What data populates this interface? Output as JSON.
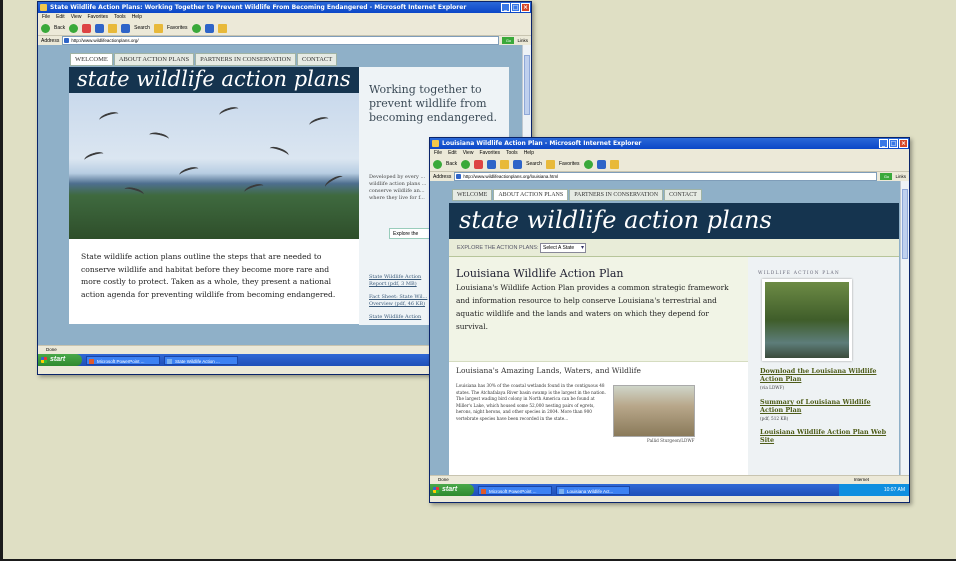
{
  "window1": {
    "title": "State Wildlife Action Plans: Working Together to Prevent Wildlife From Becoming Endangered - Microsoft Internet Explorer",
    "menu": [
      "File",
      "Edit",
      "View",
      "Favorites",
      "Tools",
      "Help"
    ],
    "toolbar": {
      "back": "Back",
      "search": "Search",
      "favorites": "Favorites"
    },
    "address_label": "Address",
    "address": "http://www.wildlifeactionplans.org/",
    "go": "Go",
    "links": "Links",
    "status": "Done",
    "taskbar": {
      "start": "start",
      "task1": "Microsoft PowerPoint ...",
      "task2": "State Wildlife Action ..."
    },
    "site": {
      "tabs": [
        "WELCOME",
        "ABOUT ACTION PLANS",
        "PARTNERS IN CONSERVATION",
        "CONTACT"
      ],
      "banner": "state wildlife action plans",
      "tagline": "Working together to prevent wildlife from becoming endangered.",
      "intro": "State wildlife action plans outline the steps that are needed to conserve wildlife and habitat before they become more rare and more costly to protect. Taken as a whole, they present a national action agenda for preventing wildlife from becoming endangered.",
      "side_text": "Developed by every ... wildlife action plans ... conserve wildlife an... where they live for f...",
      "explore_button": "Explore the",
      "side_links": [
        "State Wildlife Action Report (pdf, 3 MB)",
        "Fact Sheet: State Wil... Overview (pdf, 46 KB)",
        "State Wildlife Action"
      ]
    }
  },
  "window2": {
    "title": "Louisiana Wildlife Action Plan - Microsoft Internet Explorer",
    "menu": [
      "File",
      "Edit",
      "View",
      "Favorites",
      "Tools",
      "Help"
    ],
    "toolbar": {
      "back": "Back",
      "search": "Search",
      "favorites": "Favorites"
    },
    "address_label": "Address",
    "address": "http://www.wildlifeactionplans.org/louisiana.html",
    "go": "Go",
    "links": "Links",
    "status": "Done",
    "status_right": "Internet",
    "taskbar": {
      "start": "start",
      "task1": "Microsoft PowerPoint ...",
      "task2": "Louisiana Wildlife Act...",
      "clock": "10:07 AM"
    },
    "site": {
      "tabs": [
        "WELCOME",
        "ABOUT ACTION PLANS",
        "PARTNERS IN CONSERVATION",
        "CONTACT"
      ],
      "banner": "state wildlife action plans",
      "explore_label": "EXPLORE THE ACTION PLANS:",
      "select_value": "Select A State",
      "heading": "Louisiana Wildlife Action Plan",
      "intro": "Louisiana's Wildlife Action Plan provides a common strategic framework and information resource to help conserve Louisiana's terrestrial and aquatic wildlife and the lands and waters on which they depend for survival.",
      "subheading": "Louisiana's Amazing Lands, Waters, and Wildlife",
      "body": "Louisiana has 30% of the coastal wetlands found in the contiguous 48 states. The Atchafalaya River basin swamp is the largest in the nation. The largest wading bird colony in North America can be found at Miller's Lake, which housed some 52,000 nesting pairs of egrets, herons, night herons, and other species in 2004. More than 900 vertebrate species have been recorded in the state...",
      "photo_caption": "Pallid Sturgeon/LDWF",
      "rail_heading": "WILDLIFE ACTION PLAN",
      "rail_links": [
        {
          "label": "Download the Louisiana Wildlife Action Plan",
          "note": "(via LDWF)"
        },
        {
          "label": "Summary of Louisiana Wildlife Action Plan",
          "note": "(pdf, 512 KB)"
        },
        {
          "label": "Louisiana Wildlife Action Plan Web Site",
          "note": ""
        }
      ]
    }
  }
}
